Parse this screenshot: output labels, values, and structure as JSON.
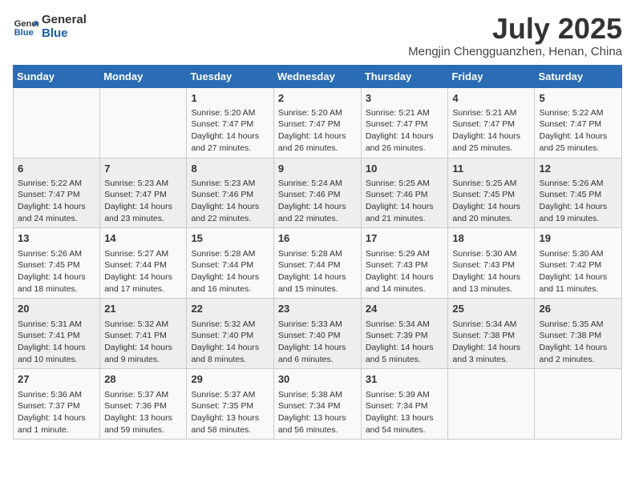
{
  "header": {
    "logo_line1": "General",
    "logo_line2": "Blue",
    "month_year": "July 2025",
    "location": "Mengjin Chengguanzhen, Henan, China"
  },
  "weekdays": [
    "Sunday",
    "Monday",
    "Tuesday",
    "Wednesday",
    "Thursday",
    "Friday",
    "Saturday"
  ],
  "weeks": [
    [
      {
        "day": "",
        "info": ""
      },
      {
        "day": "",
        "info": ""
      },
      {
        "day": "1",
        "info": "Sunrise: 5:20 AM\nSunset: 7:47 PM\nDaylight: 14 hours and 27 minutes."
      },
      {
        "day": "2",
        "info": "Sunrise: 5:20 AM\nSunset: 7:47 PM\nDaylight: 14 hours and 26 minutes."
      },
      {
        "day": "3",
        "info": "Sunrise: 5:21 AM\nSunset: 7:47 PM\nDaylight: 14 hours and 26 minutes."
      },
      {
        "day": "4",
        "info": "Sunrise: 5:21 AM\nSunset: 7:47 PM\nDaylight: 14 hours and 25 minutes."
      },
      {
        "day": "5",
        "info": "Sunrise: 5:22 AM\nSunset: 7:47 PM\nDaylight: 14 hours and 25 minutes."
      }
    ],
    [
      {
        "day": "6",
        "info": "Sunrise: 5:22 AM\nSunset: 7:47 PM\nDaylight: 14 hours and 24 minutes."
      },
      {
        "day": "7",
        "info": "Sunrise: 5:23 AM\nSunset: 7:47 PM\nDaylight: 14 hours and 23 minutes."
      },
      {
        "day": "8",
        "info": "Sunrise: 5:23 AM\nSunset: 7:46 PM\nDaylight: 14 hours and 22 minutes."
      },
      {
        "day": "9",
        "info": "Sunrise: 5:24 AM\nSunset: 7:46 PM\nDaylight: 14 hours and 22 minutes."
      },
      {
        "day": "10",
        "info": "Sunrise: 5:25 AM\nSunset: 7:46 PM\nDaylight: 14 hours and 21 minutes."
      },
      {
        "day": "11",
        "info": "Sunrise: 5:25 AM\nSunset: 7:45 PM\nDaylight: 14 hours and 20 minutes."
      },
      {
        "day": "12",
        "info": "Sunrise: 5:26 AM\nSunset: 7:45 PM\nDaylight: 14 hours and 19 minutes."
      }
    ],
    [
      {
        "day": "13",
        "info": "Sunrise: 5:26 AM\nSunset: 7:45 PM\nDaylight: 14 hours and 18 minutes."
      },
      {
        "day": "14",
        "info": "Sunrise: 5:27 AM\nSunset: 7:44 PM\nDaylight: 14 hours and 17 minutes."
      },
      {
        "day": "15",
        "info": "Sunrise: 5:28 AM\nSunset: 7:44 PM\nDaylight: 14 hours and 16 minutes."
      },
      {
        "day": "16",
        "info": "Sunrise: 5:28 AM\nSunset: 7:44 PM\nDaylight: 14 hours and 15 minutes."
      },
      {
        "day": "17",
        "info": "Sunrise: 5:29 AM\nSunset: 7:43 PM\nDaylight: 14 hours and 14 minutes."
      },
      {
        "day": "18",
        "info": "Sunrise: 5:30 AM\nSunset: 7:43 PM\nDaylight: 14 hours and 13 minutes."
      },
      {
        "day": "19",
        "info": "Sunrise: 5:30 AM\nSunset: 7:42 PM\nDaylight: 14 hours and 11 minutes."
      }
    ],
    [
      {
        "day": "20",
        "info": "Sunrise: 5:31 AM\nSunset: 7:41 PM\nDaylight: 14 hours and 10 minutes."
      },
      {
        "day": "21",
        "info": "Sunrise: 5:32 AM\nSunset: 7:41 PM\nDaylight: 14 hours and 9 minutes."
      },
      {
        "day": "22",
        "info": "Sunrise: 5:32 AM\nSunset: 7:40 PM\nDaylight: 14 hours and 8 minutes."
      },
      {
        "day": "23",
        "info": "Sunrise: 5:33 AM\nSunset: 7:40 PM\nDaylight: 14 hours and 6 minutes."
      },
      {
        "day": "24",
        "info": "Sunrise: 5:34 AM\nSunset: 7:39 PM\nDaylight: 14 hours and 5 minutes."
      },
      {
        "day": "25",
        "info": "Sunrise: 5:34 AM\nSunset: 7:38 PM\nDaylight: 14 hours and 3 minutes."
      },
      {
        "day": "26",
        "info": "Sunrise: 5:35 AM\nSunset: 7:38 PM\nDaylight: 14 hours and 2 minutes."
      }
    ],
    [
      {
        "day": "27",
        "info": "Sunrise: 5:36 AM\nSunset: 7:37 PM\nDaylight: 14 hours and 1 minute."
      },
      {
        "day": "28",
        "info": "Sunrise: 5:37 AM\nSunset: 7:36 PM\nDaylight: 13 hours and 59 minutes."
      },
      {
        "day": "29",
        "info": "Sunrise: 5:37 AM\nSunset: 7:35 PM\nDaylight: 13 hours and 58 minutes."
      },
      {
        "day": "30",
        "info": "Sunrise: 5:38 AM\nSunset: 7:34 PM\nDaylight: 13 hours and 56 minutes."
      },
      {
        "day": "31",
        "info": "Sunrise: 5:39 AM\nSunset: 7:34 PM\nDaylight: 13 hours and 54 minutes."
      },
      {
        "day": "",
        "info": ""
      },
      {
        "day": "",
        "info": ""
      }
    ]
  ]
}
